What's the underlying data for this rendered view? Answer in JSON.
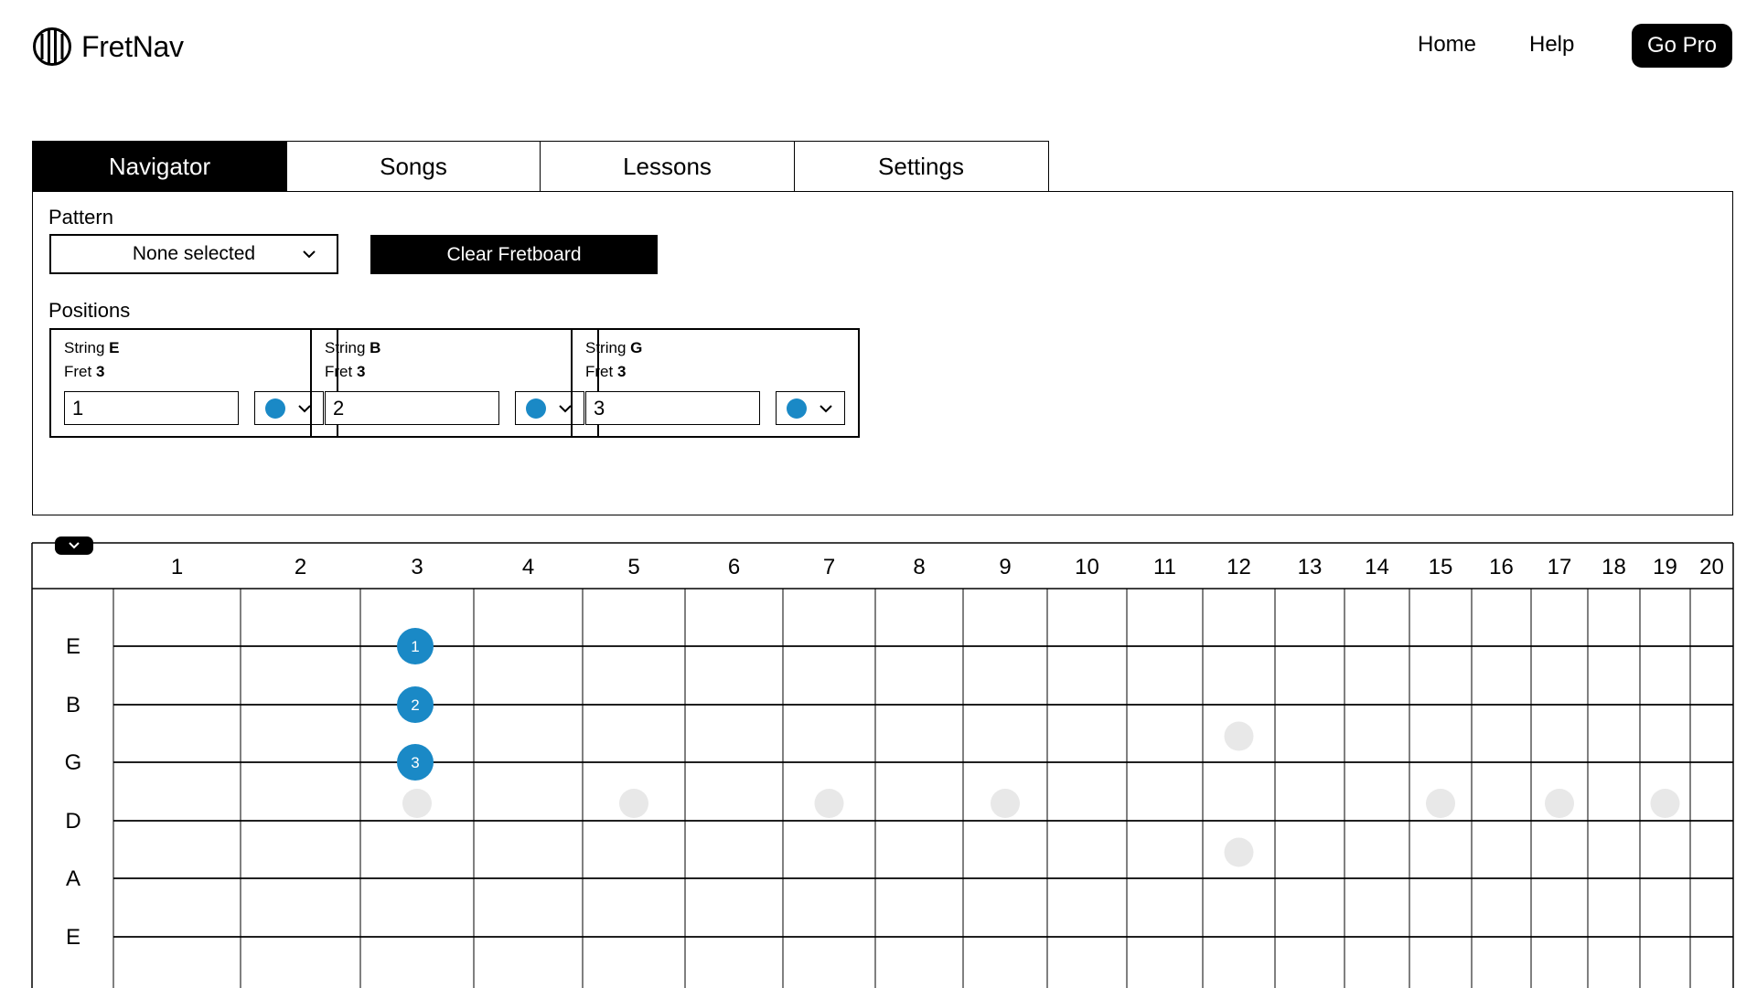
{
  "app": {
    "brand": "FretNav",
    "logo_icon": "guitar-strings-icon"
  },
  "nav": {
    "home": "Home",
    "help": "Help",
    "go_pro": "Go Pro"
  },
  "tabs": [
    {
      "label": "Navigator",
      "active": true
    },
    {
      "label": "Songs",
      "active": false
    },
    {
      "label": "Lessons",
      "active": false
    },
    {
      "label": "Settings",
      "active": false
    }
  ],
  "navigator": {
    "pattern_label": "Pattern",
    "pattern_value": "None selected",
    "clear_button": "Clear Fretboard",
    "positions_label": "Positions",
    "string_prefix": "String",
    "fret_prefix": "Fret",
    "positions": [
      {
        "string": "E",
        "fret": "3",
        "value": "1",
        "color": "#1a89c6"
      },
      {
        "string": "B",
        "fret": "3",
        "value": "2",
        "color": "#1a89c6"
      },
      {
        "string": "G",
        "fret": "3",
        "value": "3",
        "color": "#1a89c6"
      }
    ]
  },
  "fretboard": {
    "collapse_icon": "chevron-down-icon",
    "fret_numbers": [
      "1",
      "2",
      "3",
      "4",
      "5",
      "6",
      "7",
      "8",
      "9",
      "10",
      "11",
      "12",
      "13",
      "14",
      "15",
      "16",
      "17",
      "18",
      "19",
      "20"
    ],
    "strings": [
      "E",
      "B",
      "G",
      "D",
      "A",
      "E"
    ],
    "single_dot_frets": [
      3,
      5,
      7,
      9,
      15,
      17,
      19
    ],
    "double_dot_frets": [
      12
    ],
    "inlay_color": "#e8e8e8",
    "notes": [
      {
        "string_index": 0,
        "fret": 3,
        "label": "1",
        "color": "#1a89c6"
      },
      {
        "string_index": 1,
        "fret": 3,
        "label": "2",
        "color": "#1a89c6"
      },
      {
        "string_index": 2,
        "fret": 3,
        "label": "3",
        "color": "#1a89c6"
      }
    ]
  }
}
